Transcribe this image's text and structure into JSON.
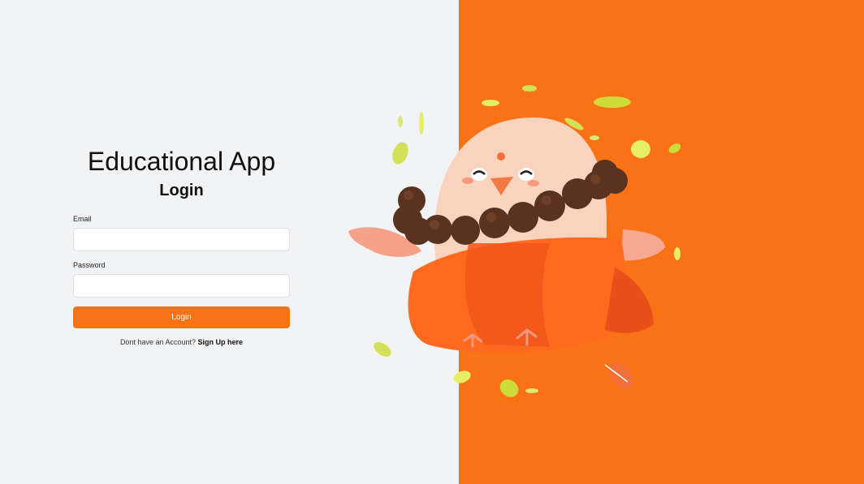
{
  "app": {
    "title": "Educational App"
  },
  "form": {
    "heading": "Login",
    "email_label": "Email",
    "email_value": "",
    "password_label": "Password",
    "password_value": "",
    "submit_label": "Login",
    "signup_prompt": "Dont have an Account?",
    "signup_link": "Sign Up here"
  },
  "illustration": {
    "name": "mascot-illustration"
  },
  "colors": {
    "accent": "#f97316",
    "background": "#f2f3f5"
  }
}
